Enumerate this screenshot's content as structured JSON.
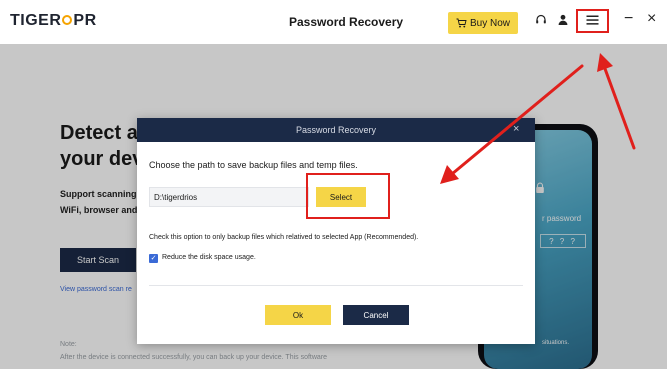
{
  "app": {
    "logo_text_before": "TIGER",
    "logo_text_after": "PR",
    "title": "Password Recovery",
    "buy_label": "Buy Now"
  },
  "background": {
    "headline_line1": "Detect ac",
    "headline_line2": "your devi",
    "support_line1": "Support scanning",
    "support_line2": "WiFi, browser and",
    "start_scan": "Start Scan",
    "scan_link": "View password scan re",
    "note_label": "Note:",
    "note_text": "After the device is connected successfully, you can back up your device. This software"
  },
  "phone": {
    "password_text": "r password",
    "pin_text": "? ? ?",
    "situations_text": "situations."
  },
  "dialog": {
    "title": "Password Recovery",
    "close_glyph": "×",
    "choose_text": "Choose the path to save backup files and temp files.",
    "path_value": "D:\\tigerdrios",
    "select_label": "Select",
    "option_text": "Check this option to only backup files which relatived to selected App (Recommended).",
    "checkbox_label": "Reduce the disk space usage.",
    "ok_label": "Ok",
    "cancel_label": "Cancel"
  },
  "colors": {
    "navy": "#1b2a47",
    "yellow": "#f5d547",
    "annotation_red": "#e0201c",
    "link_blue": "#3a6ad6"
  },
  "icons": [
    "cart-icon",
    "headset-icon",
    "user-icon",
    "menu-icon",
    "minimize-icon",
    "close-icon",
    "lock-icon",
    "checkbox-checked-icon"
  ]
}
